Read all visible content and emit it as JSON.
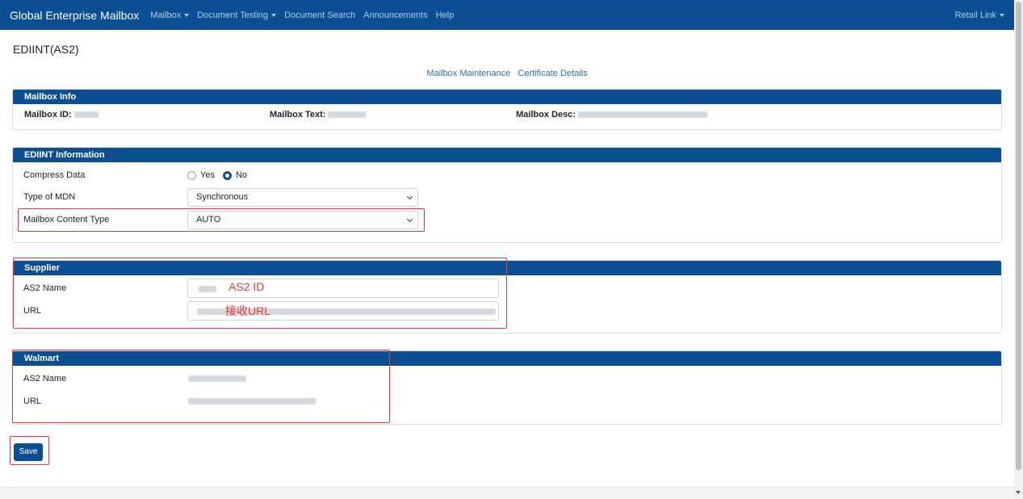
{
  "navbar": {
    "brand": "Global Enterprise Mailbox",
    "items": [
      {
        "label": "Mailbox",
        "has_dropdown": true
      },
      {
        "label": "Document Testing",
        "has_dropdown": true
      },
      {
        "label": "Document Search",
        "has_dropdown": false
      },
      {
        "label": "Announcements",
        "has_dropdown": false
      },
      {
        "label": "Help",
        "has_dropdown": false
      }
    ],
    "user_menu": "Retail Link"
  },
  "page": {
    "title": "EDIINT(AS2)",
    "links": [
      "Mailbox Maintenance",
      "Certificate Details"
    ]
  },
  "mailbox_info": {
    "header": "Mailbox Info",
    "id_label": "Mailbox ID:",
    "text_label": "Mailbox Text:",
    "desc_label": "Mailbox Desc:"
  },
  "ediint": {
    "header": "EDIINT Information",
    "compress_label": "Compress Data",
    "compress_options": [
      "Yes",
      "No"
    ],
    "compress_selected": "No",
    "mdn_label": "Type of MDN",
    "mdn_value": "Synchronous",
    "content_type_label": "Mailbox Content Type",
    "content_type_value": "AUTO"
  },
  "supplier": {
    "header": "Supplier",
    "as2_label": "AS2 Name",
    "url_label": "URL",
    "as2_annotation": "AS2 ID",
    "url_annotation": "接收URL"
  },
  "walmart": {
    "header": "Walmart",
    "as2_label": "AS2 Name",
    "url_label": "URL"
  },
  "actions": {
    "save": "Save"
  },
  "colors": {
    "primary": "#0b4f92",
    "nav_link": "#aecde9",
    "link": "#2672b6",
    "annotation": "#e53935"
  }
}
